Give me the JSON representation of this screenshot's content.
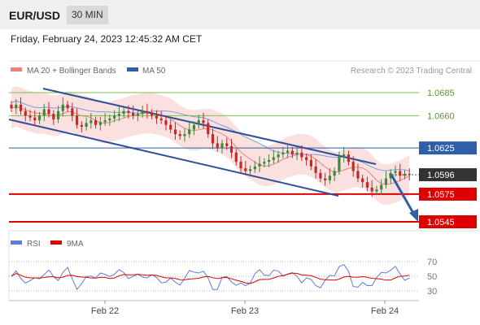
{
  "header": {
    "symbol": "EUR/USD",
    "timeframe": "30 MIN"
  },
  "datetime": "Friday, February 24, 2023 12:45:32 AM CET",
  "legend": {
    "ma20": {
      "label": "MA 20 + Bollinger Bands",
      "color": "#f08080"
    },
    "ma50": {
      "label": "MA 50",
      "color": "#2e5fa8"
    },
    "credit": "Research © 2023 Trading Central"
  },
  "rsi_legend": {
    "rsi": {
      "label": "RSI",
      "color": "#5b7fd8"
    },
    "ma9": {
      "label": "9MA",
      "color": "#e00000"
    }
  },
  "price_levels": [
    {
      "value": "1.0685",
      "kind": "resistance",
      "color": "#7cbf4a"
    },
    {
      "value": "1.0660",
      "kind": "resistance",
      "color": "#7cbf4a"
    },
    {
      "value": "1.0625",
      "kind": "ma",
      "color": "#2e5fa8"
    },
    {
      "value": "1.0596",
      "kind": "last",
      "color": "#333333"
    },
    {
      "value": "1.0575",
      "kind": "support",
      "color": "#e00000"
    },
    {
      "value": "1.0545",
      "kind": "support",
      "color": "#e00000"
    }
  ],
  "rsi_levels": [
    "70",
    "50",
    "30"
  ],
  "x_labels": [
    "Feb 22",
    "Feb 23",
    "Feb 24"
  ],
  "chart_data": {
    "type": "candlestick",
    "price_range": [
      1.0535,
      1.0705
    ],
    "channel": {
      "upper": [
        [
          1.0705,
          1.061
        ]
      ],
      "lower": [
        [
          1.0655,
          1.057
        ]
      ]
    },
    "close": [
      1.0668,
      1.0672,
      1.0665,
      1.066,
      1.0658,
      1.0655,
      1.066,
      1.0667,
      1.0662,
      1.0656,
      1.0665,
      1.0672,
      1.0668,
      1.066,
      1.065,
      1.0648,
      1.0652,
      1.0655,
      1.065,
      1.0653,
      1.0655,
      1.0657,
      1.066,
      1.0662,
      1.0665,
      1.0663,
      1.066,
      1.0662,
      1.0665,
      1.0663,
      1.066,
      1.0657,
      1.0655,
      1.065,
      1.0645,
      1.064,
      1.0638,
      1.064,
      1.0645,
      1.065,
      1.0655,
      1.0652,
      1.064,
      1.063,
      1.0625,
      1.063,
      1.0627,
      1.062,
      1.061,
      1.0603,
      1.06,
      1.0602,
      1.0605,
      1.0608,
      1.061,
      1.0612,
      1.0615,
      1.0618,
      1.062,
      1.0622,
      1.0618,
      1.062,
      1.0615,
      1.0612,
      1.0605,
      1.0598,
      1.0592,
      1.059,
      1.0595,
      1.06,
      1.0615,
      1.0618,
      1.061,
      1.06,
      1.0592,
      1.0588,
      1.0582,
      1.0578,
      1.058,
      1.0585,
      1.0592,
      1.0598,
      1.06,
      1.0595,
      1.0597,
      1.0596
    ]
  }
}
